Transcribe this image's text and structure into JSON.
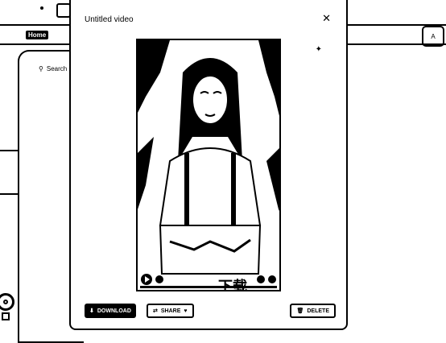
{
  "app": {
    "nav": {
      "home_label": "Home"
    },
    "search": {
      "label": "Search"
    },
    "right_chip_label": "A"
  },
  "modal": {
    "title": "Untitled video",
    "video": {
      "caption": "下载",
      "controls": [
        "play-icon",
        "sound-icon",
        "settings-icon",
        "fullscreen-icon"
      ]
    },
    "actions": {
      "download_label": "DOWNLOAD",
      "share_label": "SHARE",
      "delete_label": "DELETE"
    }
  }
}
